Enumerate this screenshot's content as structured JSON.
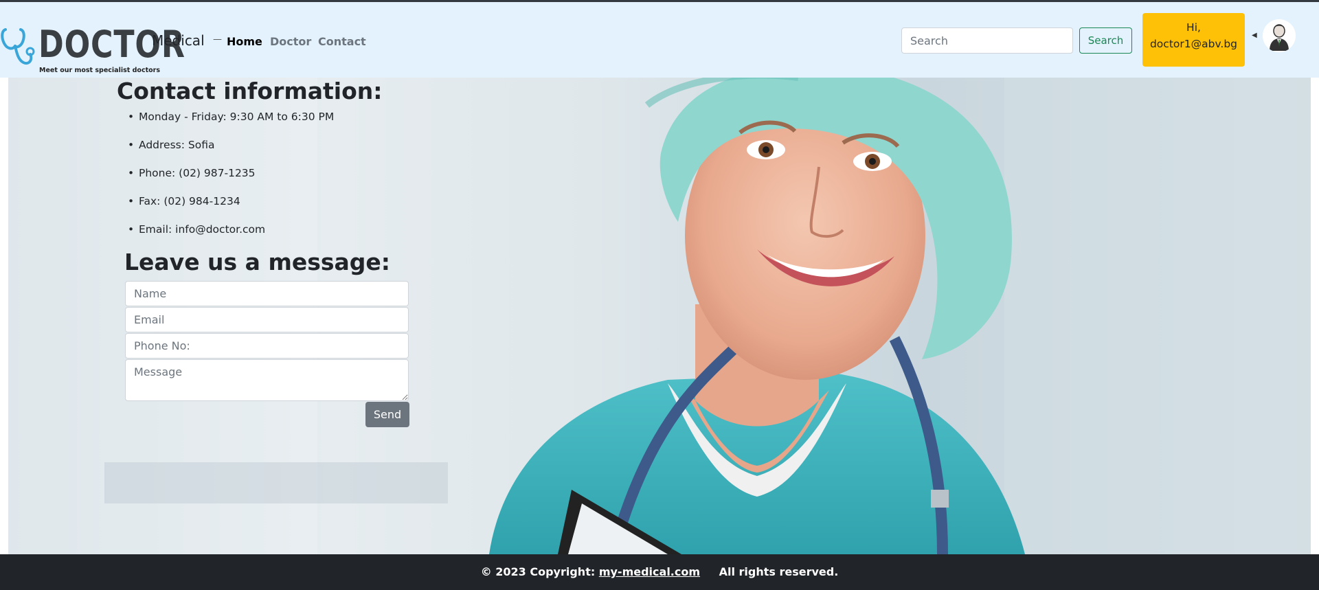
{
  "header": {
    "logo_word": "DOCTOR",
    "logo_tagline": "Meet our most specialist doctors",
    "brand": "Medical",
    "nav": [
      {
        "label": "Home",
        "active": true
      },
      {
        "label": "Doctor",
        "active": false
      },
      {
        "label": "Contact",
        "active": false
      }
    ],
    "search": {
      "placeholder": "Search",
      "value": "",
      "button_label": "Search"
    },
    "user": {
      "greeting": "Hi,",
      "email": "doctor1@abv.bg"
    },
    "icons": [
      "stethoscope-icon",
      "caret-icon",
      "user-avatar-icon"
    ]
  },
  "contact": {
    "title": "Contact information:",
    "items": [
      "Monday - Friday: 9:30 AM to 6:30 PM",
      "Address: Sofia",
      "Phone: (02) 987-1235",
      "Fax: (02) 984-1234",
      "Email: info@doctor.com"
    ]
  },
  "form": {
    "title": "Leave us a message:",
    "name_placeholder": "Name",
    "email_placeholder": "Email",
    "phone_placeholder": "Phone No:",
    "message_placeholder": "Message",
    "send_label": "Send"
  },
  "footer": {
    "copyright": "© 2023 Copyright:",
    "link": "my-medical.com",
    "rights": "All rights reserved."
  },
  "colors": {
    "navbar_bg": "#e3f2fd",
    "user_box": "#ffc107",
    "search_button": "#198754",
    "send_button": "#6c757d",
    "footer_bg": "#212529"
  }
}
